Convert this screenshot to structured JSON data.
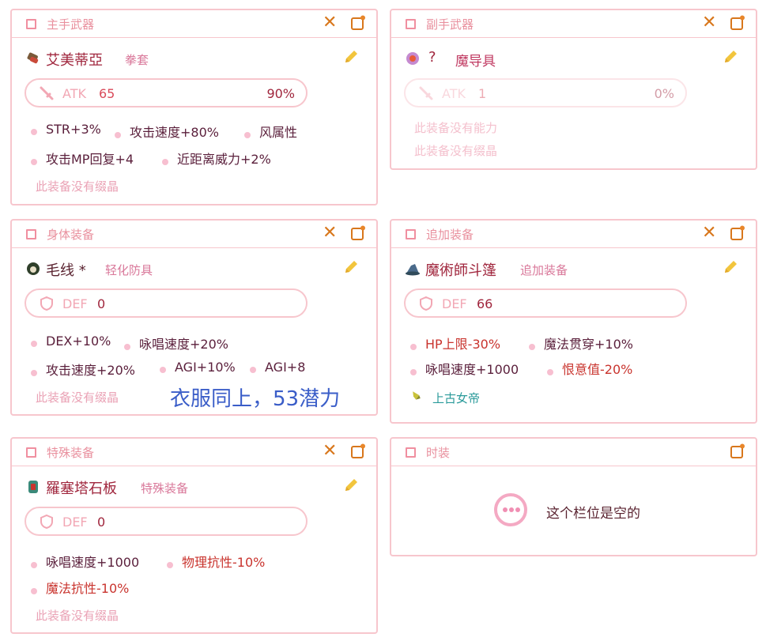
{
  "cards": {
    "main_weapon": {
      "title": "主手武器",
      "item_name": "艾美蒂亞",
      "item_type": "拳套",
      "stat_label": "ATK",
      "stat_value": "65",
      "stat_percent": "90%",
      "attrs": [
        "STR+3%",
        "攻击速度+80%",
        "风属性",
        "攻击MP回复+4",
        "近距离威力+2%"
      ],
      "no_crystal": "此装备没有缀晶"
    },
    "sub_weapon": {
      "title": "副手武器",
      "item_name": "?",
      "item_type": "魔导具",
      "stat_label": "ATK",
      "stat_value": "1",
      "stat_percent": "0%",
      "no_ability": "此装备没有能力",
      "no_crystal": "此装备没有缀晶"
    },
    "body_armor": {
      "title": "身体装备",
      "item_name": "毛线 *",
      "item_type": "轻化防具",
      "stat_label": "DEF",
      "stat_value": "0",
      "attrs": [
        "DEX+10%",
        "咏唱速度+20%",
        "攻击速度+20%",
        "AGI+10%",
        "AGI+8"
      ],
      "no_crystal": "此装备没有缀晶",
      "annotation": "衣服同上，53潜力"
    },
    "additional": {
      "title": "追加装备",
      "item_name": "魔術師斗篷",
      "item_type": "追加装备",
      "stat_label": "DEF",
      "stat_value": "66",
      "attrs": [
        "HP上限-30%",
        "魔法贯穿+10%",
        "咏唱速度+1000",
        "恨意值-20%"
      ],
      "crystal": "上古女帝"
    },
    "special": {
      "title": "特殊装备",
      "item_name": "羅塞塔石板",
      "item_type": "特殊装备",
      "stat_label": "DEF",
      "stat_value": "0",
      "attrs": [
        "咏唱速度+1000",
        "物理抗性-10%",
        "魔法抗性-10%"
      ],
      "no_crystal": "此装备没有缀晶"
    },
    "fashion": {
      "title": "时装",
      "empty_text": "这个栏位是空的"
    }
  },
  "colors": {
    "border": "#f7c6cd",
    "title": "#e9909e",
    "action": "#d8771c",
    "pencil": "#f2c53d",
    "item_name": "#a0263d",
    "negative": "#c9342e",
    "annotation": "#3a5dc8"
  },
  "icons": [
    "close-icon",
    "edit-icon",
    "pencil-icon",
    "sword-icon",
    "shield-icon",
    "ellipsis-icon"
  ]
}
